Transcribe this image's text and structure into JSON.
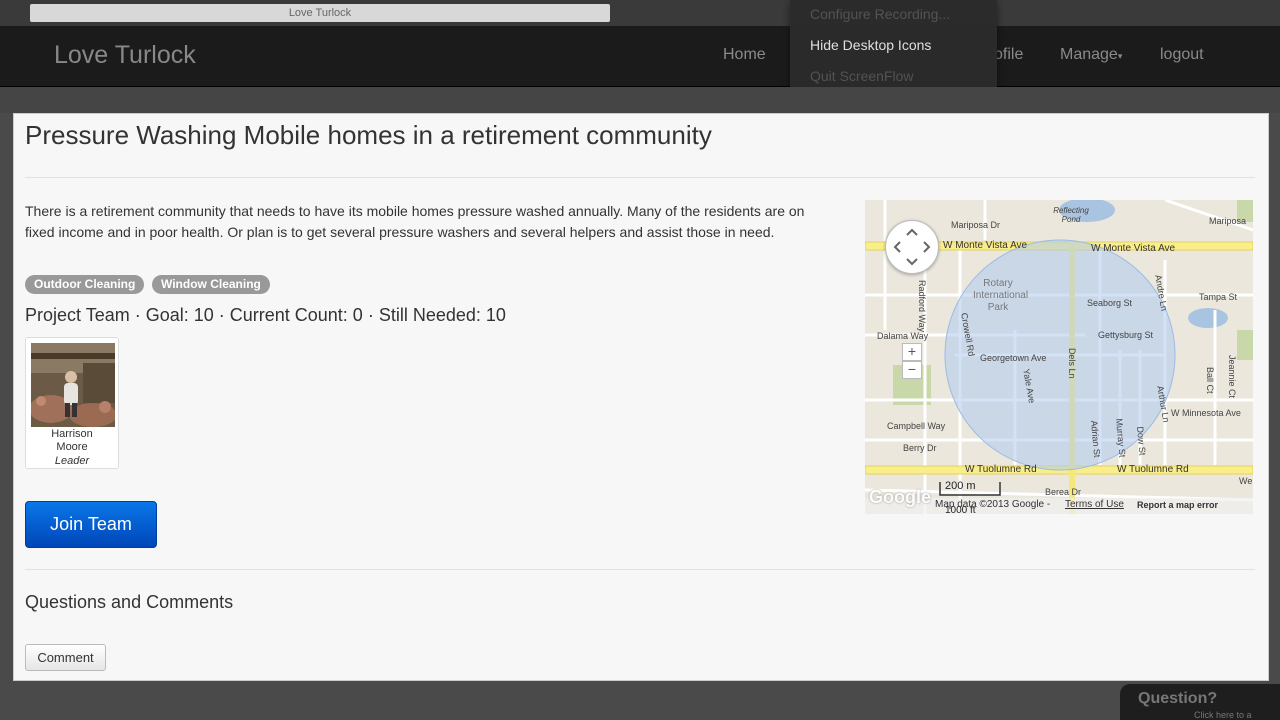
{
  "browser": {
    "tab_title": "Love Turlock"
  },
  "navbar": {
    "brand": "Love Turlock",
    "links": {
      "home": "Home",
      "profile": "ofile",
      "manage": "Manage",
      "logout": "logout"
    }
  },
  "context_menu": {
    "items": [
      "Configure Recording...",
      "Hide Desktop Icons",
      "Quit ScreenFlow"
    ]
  },
  "project": {
    "title": "Pressure Washing Mobile homes in a retirement community",
    "description": "There is a retirement community that needs to have its mobile homes pressure washed annually. Many of the residents are on fixed income and in poor health. Or plan is to get several pressure washers and several helpers and assist those in need.",
    "tags": [
      "Outdoor Cleaning",
      "Window Cleaning"
    ],
    "team_line": "Project Team · Goal: 10 · Current Count: 0 · Still Needed: 10"
  },
  "team": {
    "members": [
      {
        "name_first": "Harrison",
        "name_last": "Moore",
        "role": "Leader"
      }
    ]
  },
  "join_button": "Join Team",
  "comments": {
    "title": "Questions and Comments",
    "button": "Comment"
  },
  "map": {
    "streets": {
      "mariposa_dr": "Mariposa Dr",
      "reflecting_pond": "Reflecting Pond",
      "mariposa": "Mariposa",
      "monte_vista_left": "W Monte Vista Ave",
      "monte_vista_right": "W Monte Vista Ave",
      "radford": "Radford Way",
      "rotary": "Rotary International Park",
      "seaborg": "Seaborg St",
      "tampa": "Tampa St",
      "andre": "Andre Ln",
      "dalama": "Dalama Way",
      "crowell": "Crowell Rd",
      "gettysburg": "Gettysburg St",
      "georgetown": "Georgetown Ave",
      "dels": "Dels Ln",
      "yale": "Yale Ave",
      "ball": "Ball Ct",
      "jeannie": "Jeannie Ct",
      "arthur": "Arthur Ln",
      "minnesota": "W Minnesota Ave",
      "campbell": "Campbell Way",
      "berry": "Berry Dr",
      "adrian": "Adrian St",
      "murray": "Murray St",
      "dow": "Dow St",
      "tuolumne_left": "W Tuolumne Rd",
      "tuolumne_right": "W Tuolumne Rd",
      "berea": "Berea Dr",
      "we": "We"
    },
    "scale_m": "200 m",
    "scale_ft": "1000 ft",
    "google_logo": "Google",
    "attribution": "Map data ©2013 Google -",
    "terms": "Terms of Use",
    "report": "Report a map error",
    "zoom_in": "+",
    "zoom_out": "−"
  },
  "question_widget": {
    "title": "Question?",
    "subtitle": "Click here to a"
  },
  "colors": {
    "navbar": "#1b1b1b",
    "join_button": "#0a5fd6",
    "tag": "#999999",
    "map_circle": "#aecbef"
  }
}
